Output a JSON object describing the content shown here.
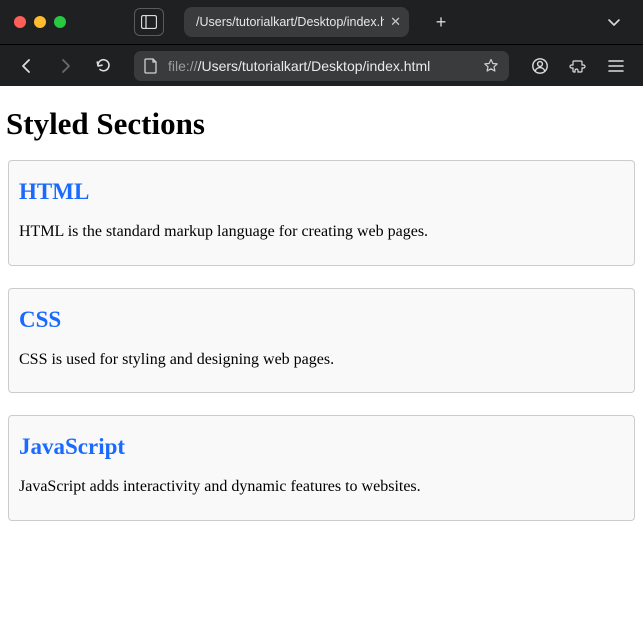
{
  "window": {
    "tab_title": "/Users/tutorialkart/Desktop/index.ht",
    "url_prefix": "file://",
    "url_path": "/Users/tutorialkart/Desktop/index.html"
  },
  "page": {
    "heading": "Styled Sections",
    "sections": [
      {
        "title": "HTML",
        "body": "HTML is the standard markup language for creating web pages."
      },
      {
        "title": "CSS",
        "body": "CSS is used for styling and designing web pages."
      },
      {
        "title": "JavaScript",
        "body": "JavaScript adds interactivity and dynamic features to websites."
      }
    ]
  }
}
